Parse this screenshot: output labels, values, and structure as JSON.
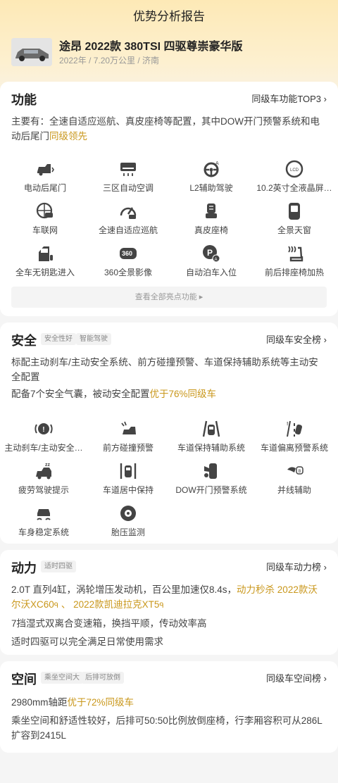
{
  "header": {
    "title": "优势分析报告",
    "car_name": "途昂 2022款 380TSI 四驱尊崇豪华版",
    "car_meta": "2022年 / 7.20万公里 / 济南"
  },
  "function": {
    "title": "功能",
    "link": "同级车功能TOP3",
    "desc_pre": "主要有：全速自适应巡航、真皮座椅等配置，其中DOW开门预警系统和电动后尾门",
    "desc_hl": "同级领先",
    "items": [
      {
        "label": "电动后尾门",
        "icon": "power-tailgate-icon"
      },
      {
        "label": "三区自动空调",
        "icon": "air-conditioner-icon"
      },
      {
        "label": "L2辅助驾驶",
        "icon": "steering-wheel-icon"
      },
      {
        "label": "10.2英寸全液晶屏…",
        "icon": "lcd-gauge-icon"
      },
      {
        "label": "车联网",
        "icon": "globe-car-icon"
      },
      {
        "label": "全速自适应巡航",
        "icon": "cruise-gauge-icon"
      },
      {
        "label": "真皮座椅",
        "icon": "leather-seat-icon"
      },
      {
        "label": "全景天窗",
        "icon": "sunroof-icon"
      },
      {
        "label": "全车无钥匙进入",
        "icon": "keyless-door-icon"
      },
      {
        "label": "360全景影像",
        "icon": "camera-360-icon"
      },
      {
        "label": "自动泊车入位",
        "icon": "auto-parking-icon"
      },
      {
        "label": "前后排座椅加热",
        "icon": "seat-heating-icon"
      }
    ],
    "all_btn": "查看全部亮点功能 ▸"
  },
  "safety": {
    "title": "安全",
    "tags": [
      "安全性好",
      "智能驾驶"
    ],
    "link": "同级车安全榜",
    "desc1": "标配主动刹车/主动安全系统、前方碰撞预警、车道保持辅助系统等主动安全配置",
    "desc2_pre": "配备7个安全气囊，被动安全配置",
    "desc2_hl": "优于76%同级车",
    "items": [
      {
        "label": "主动刹车/主动安全…",
        "icon": "brake-warning-icon"
      },
      {
        "label": "前方碰撞预警",
        "icon": "collision-warning-icon"
      },
      {
        "label": "车道保持辅助系统",
        "icon": "lane-keep-icon"
      },
      {
        "label": "车道偏离预警系统",
        "icon": "lane-departure-icon"
      },
      {
        "label": "疲劳驾驶提示",
        "icon": "fatigue-driving-icon"
      },
      {
        "label": "车道居中保持",
        "icon": "lane-center-icon"
      },
      {
        "label": "DOW开门预警系统",
        "icon": "door-open-warning-icon"
      },
      {
        "label": "并线辅助",
        "icon": "blind-spot-icon"
      },
      {
        "label": "车身稳定系统",
        "icon": "stability-control-icon"
      },
      {
        "label": "胎压监测",
        "icon": "tire-pressure-icon"
      }
    ]
  },
  "power": {
    "title": "动力",
    "tags": [
      "适时四驱"
    ],
    "link": "同级车动力榜",
    "line1_pre": "2.0T 直列4缸，涡轮增压发动机，百公里加速仅8.4s，",
    "line1_hl1": "动力秒杀 2022款沃尔沃XC60",
    "line1_sep": " 、 ",
    "line1_hl2": "2022款凯迪拉克XT5",
    "search_glyph": "ᑫ",
    "line2": "7挡湿式双离合变速箱，换挡平顺，传动效率高",
    "line3": "适时四驱可以完全满足日常使用需求"
  },
  "space": {
    "title": "空间",
    "tags": [
      "乘坐空间大",
      "后排可放倒"
    ],
    "link": "同级车空间榜",
    "line1_pre": "2980mm轴距",
    "line1_hl": "优于72%同级车",
    "line2": "乘坐空间和舒适性较好，后排可50:50比例放倒座椅，行李厢容积可从286L扩容到2415L"
  }
}
